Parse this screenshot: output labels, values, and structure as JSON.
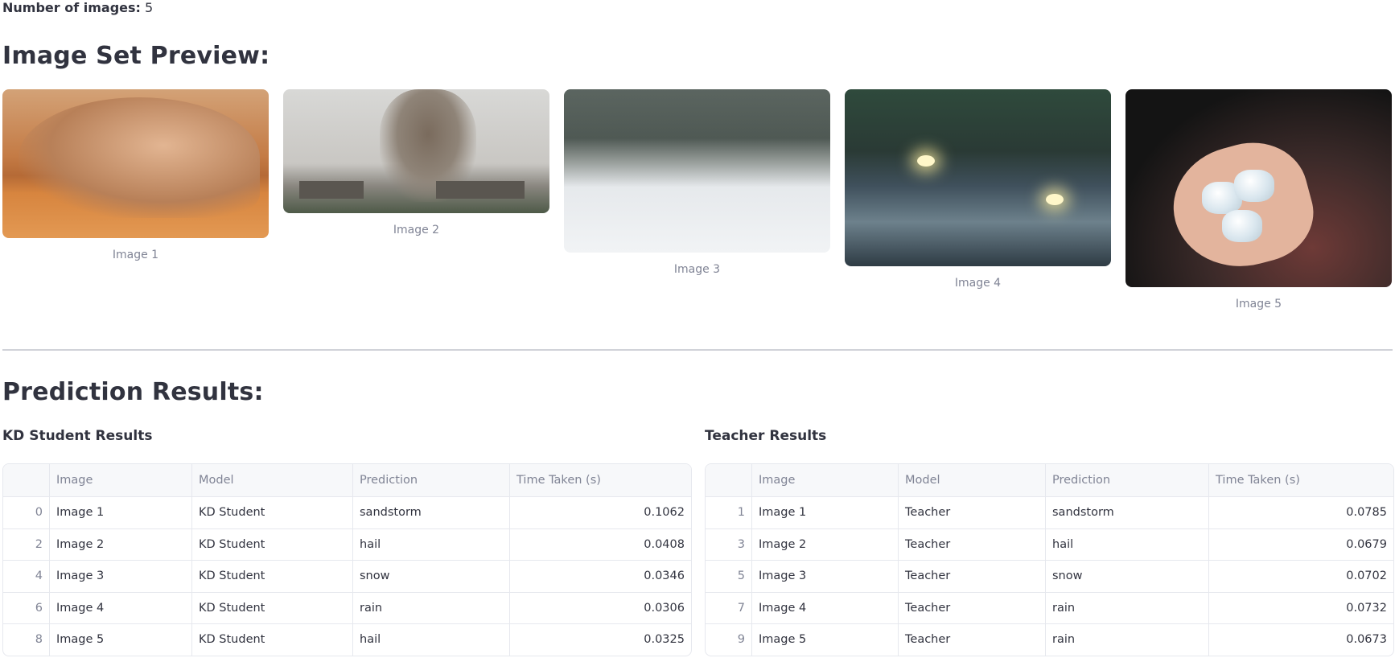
{
  "count": {
    "label": "Number of images:",
    "value": "5"
  },
  "preview": {
    "title": "Image Set Preview:",
    "images": [
      {
        "caption": "Image 1"
      },
      {
        "caption": "Image 2"
      },
      {
        "caption": "Image 3"
      },
      {
        "caption": "Image 4"
      },
      {
        "caption": "Image 5"
      }
    ]
  },
  "results": {
    "title": "Prediction Results:",
    "student": {
      "title": "KD Student Results",
      "columns": [
        "",
        "Image",
        "Model",
        "Prediction",
        "Time Taken (s)"
      ],
      "rows": [
        {
          "idx": "0",
          "image": "Image 1",
          "model": "KD Student",
          "prediction": "sandstorm",
          "time": "0.1062"
        },
        {
          "idx": "2",
          "image": "Image 2",
          "model": "KD Student",
          "prediction": "hail",
          "time": "0.0408"
        },
        {
          "idx": "4",
          "image": "Image 3",
          "model": "KD Student",
          "prediction": "snow",
          "time": "0.0346"
        },
        {
          "idx": "6",
          "image": "Image 4",
          "model": "KD Student",
          "prediction": "rain",
          "time": "0.0306"
        },
        {
          "idx": "8",
          "image": "Image 5",
          "model": "KD Student",
          "prediction": "hail",
          "time": "0.0325"
        }
      ]
    },
    "teacher": {
      "title": "Teacher Results",
      "columns": [
        "",
        "Image",
        "Model",
        "Prediction",
        "Time Taken (s)"
      ],
      "rows": [
        {
          "idx": "1",
          "image": "Image 1",
          "model": "Teacher",
          "prediction": "sandstorm",
          "time": "0.0785"
        },
        {
          "idx": "3",
          "image": "Image 2",
          "model": "Teacher",
          "prediction": "hail",
          "time": "0.0679"
        },
        {
          "idx": "5",
          "image": "Image 3",
          "model": "Teacher",
          "prediction": "snow",
          "time": "0.0702"
        },
        {
          "idx": "7",
          "image": "Image 4",
          "model": "Teacher",
          "prediction": "rain",
          "time": "0.0732"
        },
        {
          "idx": "9",
          "image": "Image 5",
          "model": "Teacher",
          "prediction": "rain",
          "time": "0.0673"
        }
      ]
    }
  }
}
